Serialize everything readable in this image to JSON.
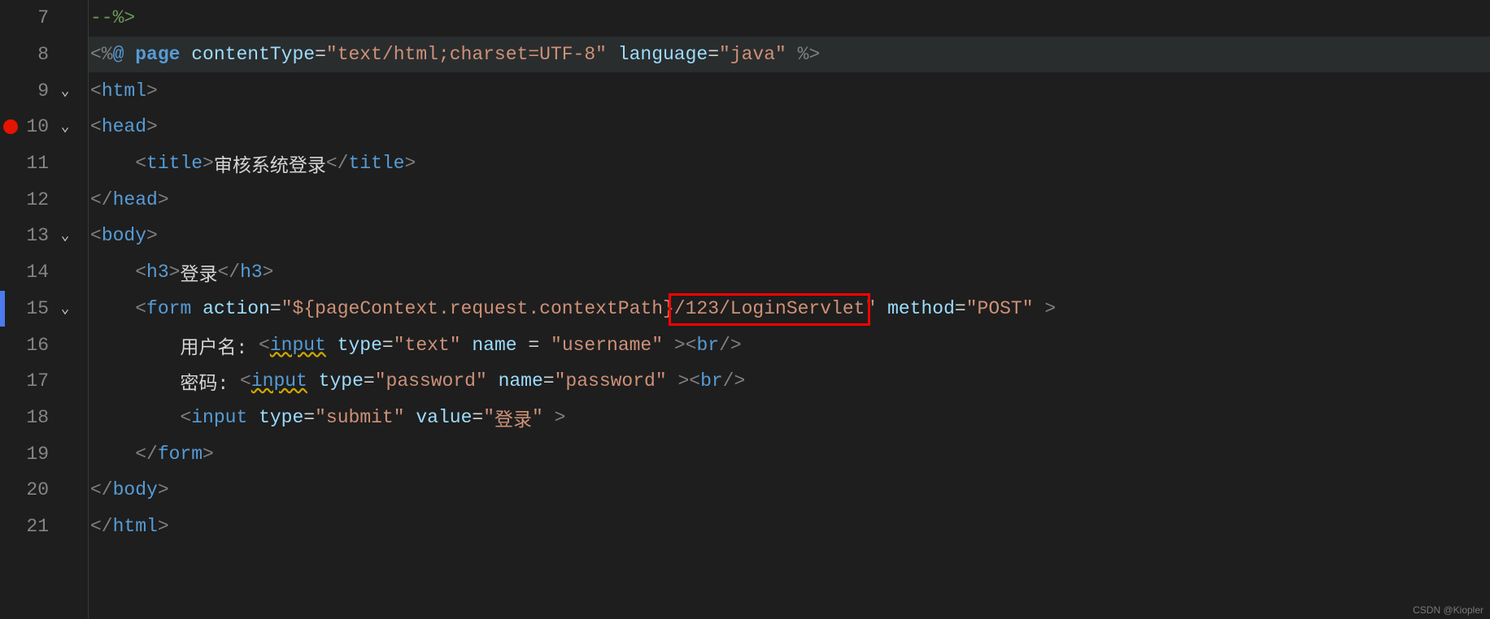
{
  "watermark": "CSDN @Kiopler",
  "lines": {
    "l7": {
      "num": "7",
      "prefix": "",
      "comment_end": "--%>"
    },
    "l8": {
      "num": "8",
      "prefix": "",
      "pct_lt": "<%",
      "at": "@ ",
      "page": "page",
      "sp": " ",
      "attr1": "contentType",
      "eq": "=",
      "q": "\"",
      "str1": "text/html;charset=UTF-8",
      "attr2": "language",
      "str2": "java",
      "pct_gt": "%>"
    },
    "l9": {
      "num": "9",
      "lt": "<",
      "tag": "html",
      "gt": ">"
    },
    "l10": {
      "num": "10",
      "lt": "<",
      "tag": "head",
      "gt": ">"
    },
    "l11": {
      "num": "11",
      "indent": "    ",
      "lt": "<",
      "tag": "title",
      "gt": ">",
      "text": "审核系统登录",
      "lt2": "</",
      "gt2": ">"
    },
    "l12": {
      "num": "12",
      "lt": "</",
      "tag": "head",
      "gt": ">"
    },
    "l13": {
      "num": "13",
      "lt": "<",
      "tag": "body",
      "gt": ">"
    },
    "l14": {
      "num": "14",
      "indent": "    ",
      "lt": "<",
      "tag": "h3",
      "gt": ">",
      "text": "登录",
      "lt2": "</",
      "gt2": ">"
    },
    "l15": {
      "num": "15",
      "indent": "    ",
      "lt": "<",
      "tag": "form",
      "sp": " ",
      "attr1": "action",
      "eq": "=",
      "q": "\"",
      "str1a": "${pageContext.request.contextPath}",
      "str1b": "/123/LoginServlet",
      "attr2": "method",
      "str2": "POST",
      "gt": ">"
    },
    "l16": {
      "num": "16",
      "indent": "        ",
      "label": "用户名: ",
      "lt": "<",
      "tag": "input",
      "sp": " ",
      "attr1": "type",
      "str1": "text",
      "attr2": "name",
      "space_eq": " = ",
      "str2": "username",
      "close": " >",
      "br_lt": "<",
      "br": "br",
      "br_sl": "/>"
    },
    "l17": {
      "num": "17",
      "indent": "        ",
      "label": "密码: ",
      "lt": "<",
      "tag": "input",
      "sp": " ",
      "attr1": "type",
      "str1": "password",
      "attr2": "name",
      "eq": "=",
      "str2": "password",
      "close": " >",
      "br_lt": "<",
      "br": "br",
      "br_sl": "/>"
    },
    "l18": {
      "num": "18",
      "indent": "        ",
      "lt": "<",
      "tag": "input",
      "sp": " ",
      "attr1": "type",
      "str1": "submit",
      "attr2": "value",
      "eq": "=",
      "str2": "登录",
      "close": " >"
    },
    "l19": {
      "num": "19",
      "indent": "    ",
      "lt": "</",
      "tag": "form",
      "gt": ">"
    },
    "l20": {
      "num": "20",
      "lt": "</",
      "tag": "body",
      "gt": ">"
    },
    "l21": {
      "num": "21",
      "lt": "</",
      "tag": "html",
      "gt": ">"
    }
  }
}
